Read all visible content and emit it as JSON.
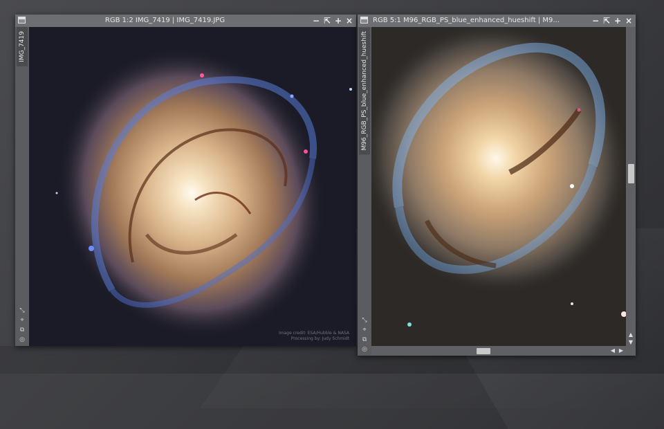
{
  "windows": [
    {
      "title": "RGB 1:2 IMG_7419 | IMG_7419.JPG",
      "side_tab": "IMG_7419",
      "credit_line1": "Image credit: ESA/Hubble & NASA",
      "credit_line2": "Processing by: Judy Schmidt"
    },
    {
      "title": "RGB 5:1 M96_RGB_PS_blue_enhanced_hueshift | M9...",
      "side_tab": "M96_RGB_PS_blue_enhanced_hueshift"
    }
  ],
  "title_buttons": [
    "−",
    "⇱",
    "+",
    "×"
  ],
  "side_icon_glyphs": [
    "⤡",
    "⌖",
    "⧉",
    "◎"
  ],
  "scroll_glyphs": {
    "up": "▲",
    "down": "▼",
    "left": "◀",
    "right": "▶"
  },
  "colors": {
    "window_frame": "#5f6064",
    "titlebar": "#6d6e72",
    "desktop": "#3f4044",
    "galaxy_core": "#fff4dc",
    "arm_blue": "#5a7bd8",
    "dust": "#5a2d18"
  }
}
